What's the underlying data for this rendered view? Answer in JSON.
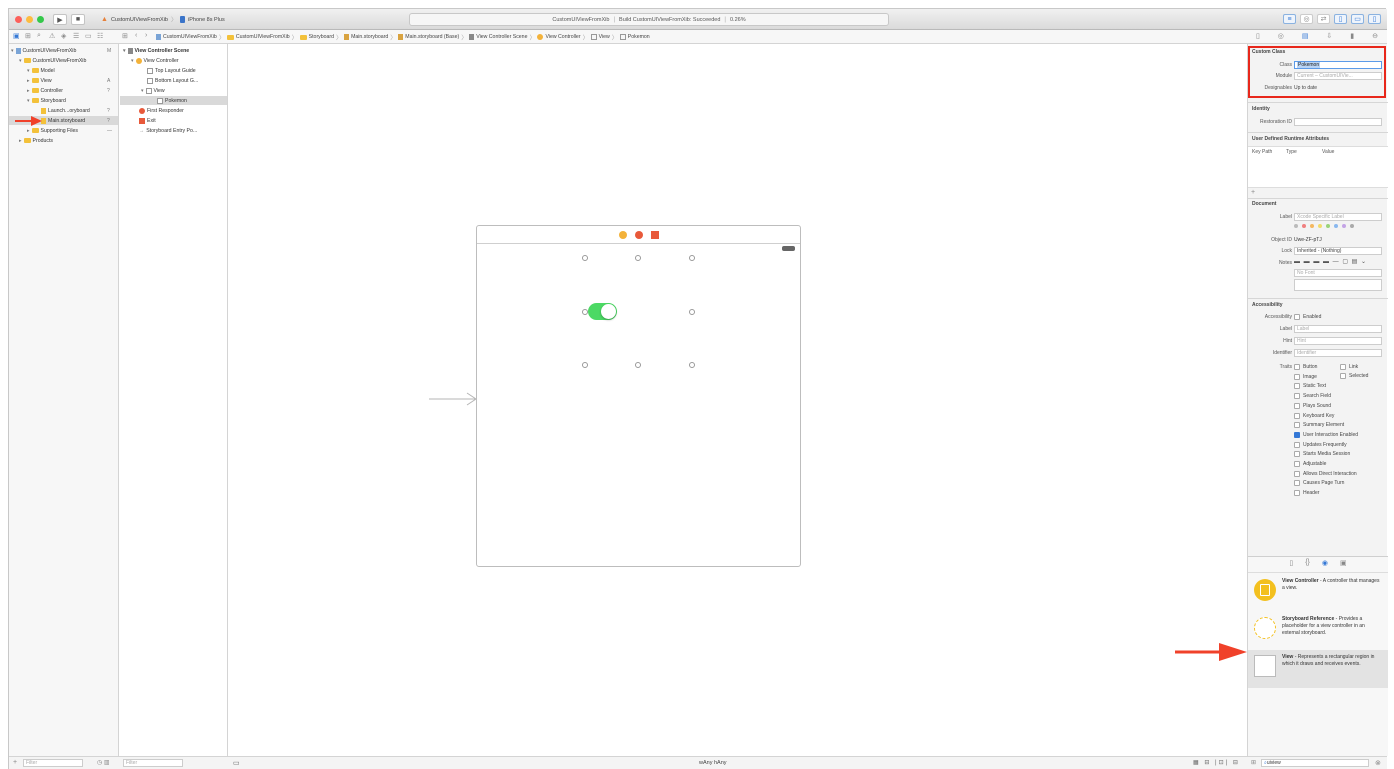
{
  "toolbar": {
    "scheme": "CustomUIViewFromXib",
    "device": "iPhone 8s Plus",
    "activity_prefix": "CustomUIViewFromXib",
    "activity_status": "Build CustomUIViewFromXib: Succeeded",
    "activity_time": "0.26%"
  },
  "jump_bar": [
    "CustomUIViewFromXib",
    "CustomUIViewFromXib",
    "Storyboard",
    "Main.storyboard",
    "Main.storyboard (Base)",
    "View Controller Scene",
    "View Controller",
    "View",
    "Pokemon"
  ],
  "navigator": {
    "items": [
      {
        "label": "CustomUIViewFromXib",
        "badge": "M"
      },
      {
        "label": "CustomUIViewFromXib",
        "badge": ""
      },
      {
        "label": "Model",
        "badge": ""
      },
      {
        "label": "View",
        "badge": "A"
      },
      {
        "label": "Controller",
        "badge": "?"
      },
      {
        "label": "Storyboard",
        "badge": ""
      },
      {
        "label": "Launch...oryboard",
        "badge": "?"
      },
      {
        "label": "Main.storyboard",
        "badge": "?"
      },
      {
        "label": "Supporting Files",
        "badge": "—"
      },
      {
        "label": "Products",
        "badge": ""
      }
    ],
    "filter_placeholder": "Filter"
  },
  "outline": {
    "items": [
      "View Controller Scene",
      "View Controller",
      "Top Layout Guide",
      "Bottom Layout G...",
      "View",
      "Pokemon",
      "First Responder",
      "Exit",
      "Storyboard Entry Po..."
    ],
    "filter_placeholder": "Filter"
  },
  "inspector": {
    "custom_class": {
      "title": "Custom Class",
      "class_label": "Class",
      "class_value": "Pokemon",
      "module_label": "Module",
      "module_value": "Current – CustomUIVie...",
      "designables_label": "Designables",
      "designables_value": "Up to date"
    },
    "identity": {
      "title": "Identity",
      "restoration_label": "Restoration ID"
    },
    "udra": {
      "title": "User Defined Runtime Attributes",
      "columns": [
        "Key Path",
        "Type",
        "Value"
      ]
    },
    "document": {
      "title": "Document",
      "label_label": "Label",
      "label_placeholder": "Xcode Specific Label",
      "object_id_label": "Object ID",
      "object_id_value": "Uwe-ZF-pTJ",
      "lock_label": "Lock",
      "lock_value": "Inherited - (Nothing)",
      "notes_label": "Notes",
      "notes_placeholder": "No Font"
    },
    "accessibility": {
      "title": "Accessibility",
      "accessibility_label": "Accessibility",
      "enabled_label": "Enabled",
      "label_label": "Label",
      "label_placeholder": "Label",
      "hint_label": "Hint",
      "hint_placeholder": "Hint",
      "identifier_label": "Identifier",
      "identifier_placeholder": "Identifier",
      "traits_label": "Traits",
      "traits_left": [
        "Button",
        "Image",
        "Static Text",
        "Search Field",
        "Plays Sound",
        "Keyboard Key",
        "Summary Element",
        "User Interaction Enabled",
        "Updates Frequently",
        "Starts Media Session",
        "Adjustable",
        "Allows Direct Interaction",
        "Causes Page Turn",
        "Header"
      ],
      "traits_checked": "User Interaction Enabled",
      "traits_right": [
        "Link",
        "Selected"
      ]
    },
    "library": [
      {
        "name": "View Controller",
        "desc": " - A controller that manages a view."
      },
      {
        "name": "Storyboard Reference",
        "desc": " - Provides a placeholder for a view controller in an external storyboard."
      },
      {
        "name": "View",
        "desc": " - Represents a rectangular region in which it draws and receives events."
      }
    ]
  },
  "bottom": {
    "size_class": "wAny hAny",
    "library_filter": "uiview"
  },
  "colors": {
    "highlight_box": "#e8271b",
    "arrow": "#f0412a",
    "switch_on": "#4cd964",
    "accent": "#3478d6"
  }
}
